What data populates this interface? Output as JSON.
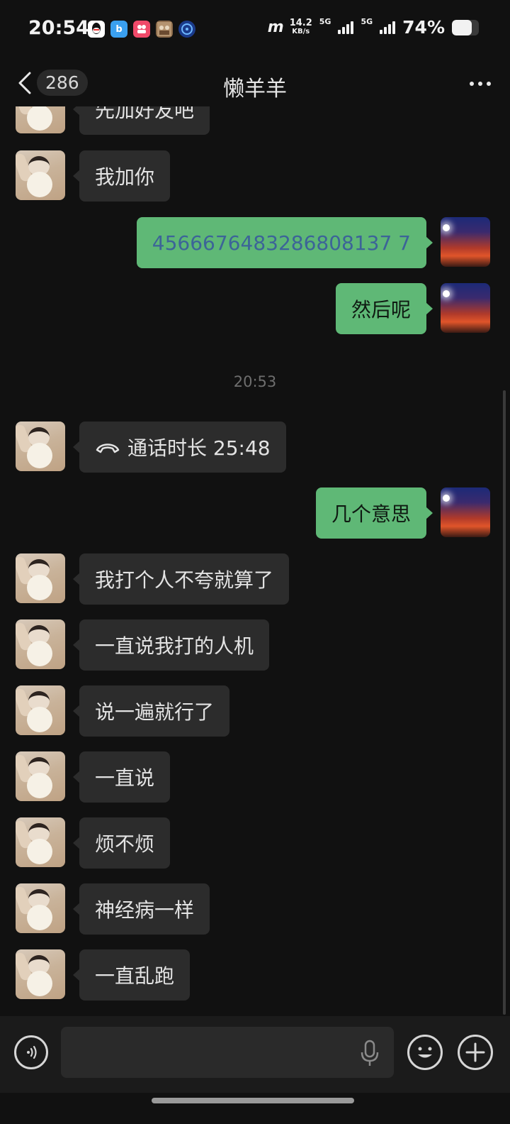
{
  "status_bar": {
    "time": "20:54",
    "net_speed_value": "14.2",
    "net_speed_unit": "KB/s",
    "network_1": "5G",
    "network_2": "5G",
    "battery_percent": "74%",
    "battery_level": 0.74,
    "carrier_logo": "m",
    "notification_icons": [
      "qq-icon",
      "app-blue-icon",
      "app-pink-icon",
      "app-photo-icon",
      "app-circle-icon"
    ]
  },
  "header": {
    "unread_count": "286",
    "title": "懒羊羊"
  },
  "messages": [
    {
      "side": "left",
      "text": "先加好友吧"
    },
    {
      "side": "left",
      "text": "我加你"
    },
    {
      "side": "right",
      "text": "4566676483286808137 7"
    },
    {
      "side": "right",
      "text": "然后呢"
    },
    {
      "type": "timestamp",
      "text": "20:53"
    },
    {
      "side": "left",
      "type": "call",
      "text": "通话时长 25:48"
    },
    {
      "side": "right",
      "text": "几个意思"
    },
    {
      "side": "left",
      "text": "我打个人不夸就算了"
    },
    {
      "side": "left",
      "text": "一直说我打的人机"
    },
    {
      "side": "left",
      "text": "说一遍就行了"
    },
    {
      "side": "left",
      "text": "一直说"
    },
    {
      "side": "left",
      "text": "烦不烦"
    },
    {
      "side": "left",
      "text": "神经病一样"
    },
    {
      "side": "left",
      "text": "一直乱跑"
    }
  ],
  "input_bar": {
    "value": "",
    "placeholder": ""
  },
  "colors": {
    "background": "#111111",
    "bubble_self": "#5fb876",
    "bubble_other": "#2c2c2c",
    "link": "#3c6498"
  }
}
